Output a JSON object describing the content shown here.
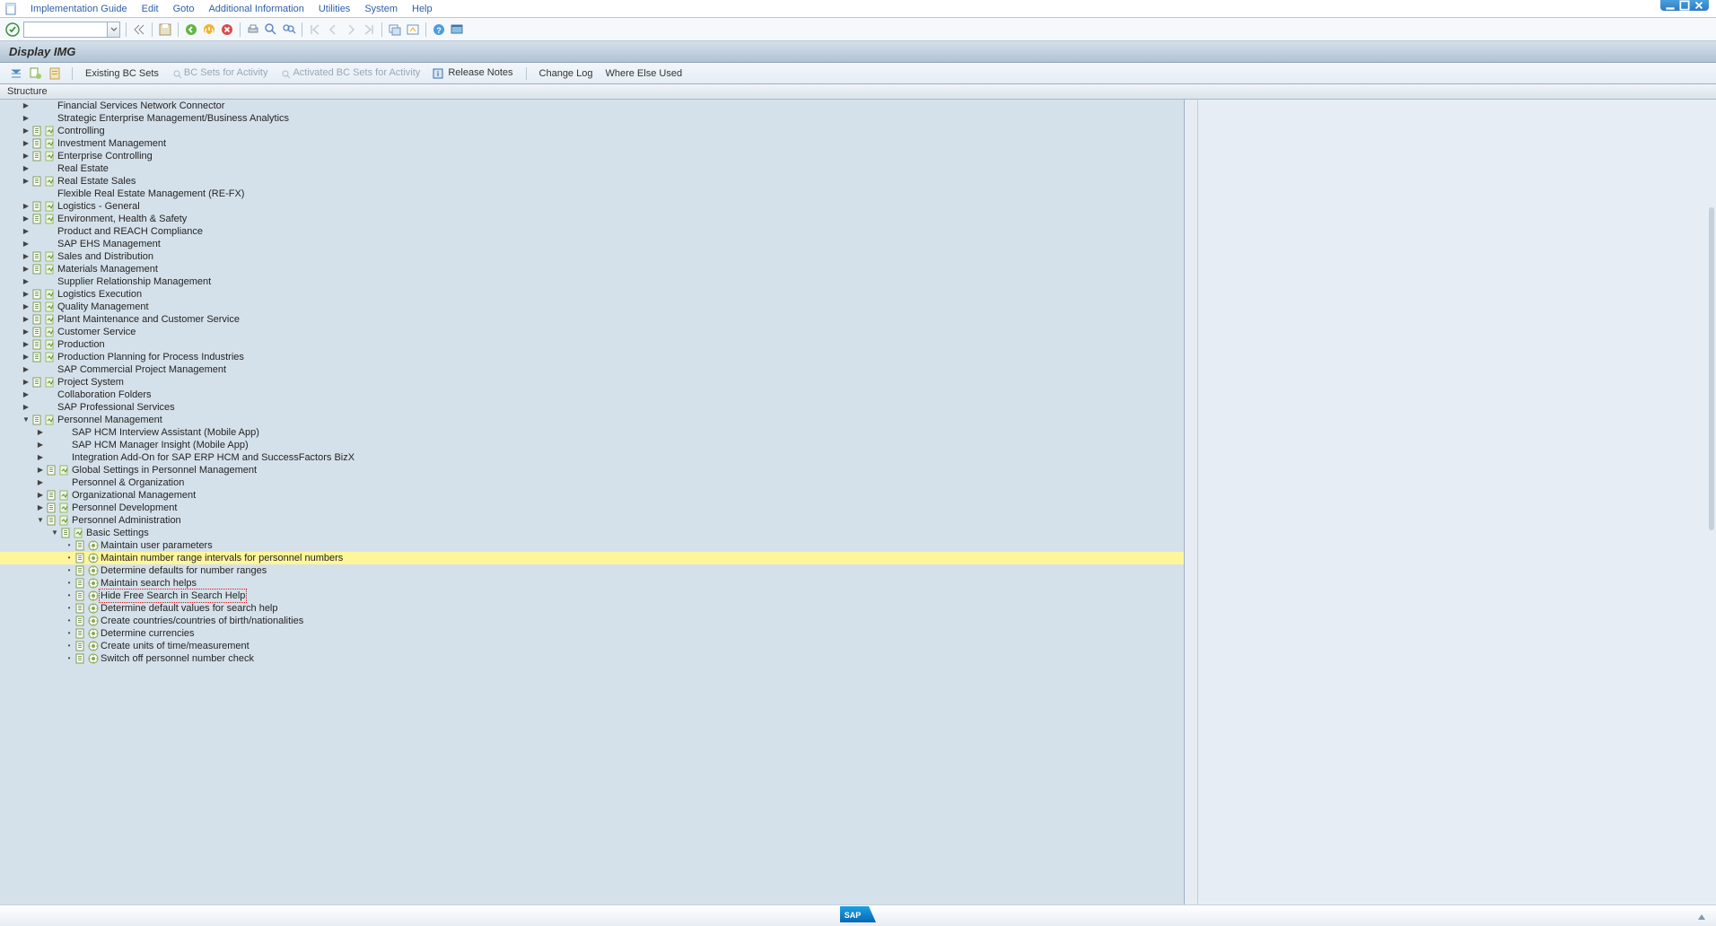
{
  "menu": {
    "items": [
      "Implementation Guide",
      "Edit",
      "Goto",
      "Additional Information",
      "Utilities",
      "System",
      "Help"
    ]
  },
  "title": "Display IMG",
  "app_toolbar": {
    "existing_bc_sets": "Existing BC Sets",
    "bc_sets_activity": "BC Sets for Activity",
    "activated_bc_sets": "Activated BC Sets for Activity",
    "release_notes": "Release Notes",
    "change_log": "Change Log",
    "where_else_used": "Where Else Used"
  },
  "tree_header": "Structure",
  "tree": [
    {
      "indent": 1,
      "exp": "closed",
      "doc": false,
      "act": false,
      "label": "Financial Services Network Connector"
    },
    {
      "indent": 1,
      "exp": "closed",
      "doc": false,
      "act": false,
      "label": "Strategic Enterprise Management/Business Analytics"
    },
    {
      "indent": 1,
      "exp": "closed",
      "doc": true,
      "act": true,
      "label": "Controlling"
    },
    {
      "indent": 1,
      "exp": "closed",
      "doc": true,
      "act": true,
      "label": "Investment Management"
    },
    {
      "indent": 1,
      "exp": "closed",
      "doc": true,
      "act": true,
      "label": "Enterprise Controlling"
    },
    {
      "indent": 1,
      "exp": "closed",
      "doc": false,
      "act": false,
      "label": "Real Estate"
    },
    {
      "indent": 1,
      "exp": "closed",
      "doc": true,
      "act": true,
      "label": "Real Estate Sales"
    },
    {
      "indent": 1,
      "exp": "none",
      "doc": false,
      "act": false,
      "label": "Flexible Real Estate Management (RE-FX)"
    },
    {
      "indent": 1,
      "exp": "closed",
      "doc": true,
      "act": true,
      "label": "Logistics - General"
    },
    {
      "indent": 1,
      "exp": "closed",
      "doc": true,
      "act": true,
      "label": "Environment, Health & Safety"
    },
    {
      "indent": 1,
      "exp": "closed",
      "doc": false,
      "act": false,
      "label": "Product and REACH Compliance"
    },
    {
      "indent": 1,
      "exp": "closed",
      "doc": false,
      "act": false,
      "label": "SAP EHS Management"
    },
    {
      "indent": 1,
      "exp": "closed",
      "doc": true,
      "act": true,
      "label": "Sales and Distribution"
    },
    {
      "indent": 1,
      "exp": "closed",
      "doc": true,
      "act": true,
      "label": "Materials Management"
    },
    {
      "indent": 1,
      "exp": "closed",
      "doc": false,
      "act": false,
      "label": "Supplier Relationship Management"
    },
    {
      "indent": 1,
      "exp": "closed",
      "doc": true,
      "act": true,
      "label": "Logistics Execution"
    },
    {
      "indent": 1,
      "exp": "closed",
      "doc": true,
      "act": true,
      "label": "Quality Management"
    },
    {
      "indent": 1,
      "exp": "closed",
      "doc": true,
      "act": true,
      "label": "Plant Maintenance and Customer Service"
    },
    {
      "indent": 1,
      "exp": "closed",
      "doc": true,
      "act": true,
      "label": "Customer Service"
    },
    {
      "indent": 1,
      "exp": "closed",
      "doc": true,
      "act": true,
      "label": "Production"
    },
    {
      "indent": 1,
      "exp": "closed",
      "doc": true,
      "act": true,
      "label": "Production Planning for Process Industries"
    },
    {
      "indent": 1,
      "exp": "closed",
      "doc": false,
      "act": false,
      "label": "SAP Commercial Project Management"
    },
    {
      "indent": 1,
      "exp": "closed",
      "doc": true,
      "act": true,
      "label": "Project System"
    },
    {
      "indent": 1,
      "exp": "closed",
      "doc": false,
      "act": false,
      "label": "Collaboration Folders"
    },
    {
      "indent": 1,
      "exp": "closed",
      "doc": false,
      "act": false,
      "label": "SAP Professional Services"
    },
    {
      "indent": 1,
      "exp": "open",
      "doc": true,
      "act": true,
      "label": "Personnel Management"
    },
    {
      "indent": 2,
      "exp": "closed",
      "doc": false,
      "act": false,
      "label": "SAP HCM Interview Assistant (Mobile App)"
    },
    {
      "indent": 2,
      "exp": "closed",
      "doc": false,
      "act": false,
      "label": "SAP HCM Manager Insight (Mobile App)"
    },
    {
      "indent": 2,
      "exp": "closed",
      "doc": false,
      "act": false,
      "label": "Integration Add-On for SAP ERP HCM and SuccessFactors BizX"
    },
    {
      "indent": 2,
      "exp": "closed",
      "doc": true,
      "act": true,
      "label": "Global Settings in Personnel Management"
    },
    {
      "indent": 2,
      "exp": "closed",
      "doc": false,
      "act": false,
      "label": "Personnel & Organization"
    },
    {
      "indent": 2,
      "exp": "closed",
      "doc": true,
      "act": true,
      "label": "Organizational Management"
    },
    {
      "indent": 2,
      "exp": "closed",
      "doc": true,
      "act": true,
      "label": "Personnel Development"
    },
    {
      "indent": 2,
      "exp": "open",
      "doc": true,
      "act": true,
      "label": "Personnel Administration"
    },
    {
      "indent": 3,
      "exp": "open",
      "doc": true,
      "act": true,
      "label": "Basic Settings"
    },
    {
      "indent": 4,
      "exp": "leaf",
      "doc": true,
      "act": true,
      "exec": true,
      "label": "Maintain user parameters"
    },
    {
      "indent": 4,
      "exp": "leaf",
      "doc": true,
      "act": true,
      "exec": true,
      "label": "Maintain number range intervals for personnel numbers",
      "highlighted": true
    },
    {
      "indent": 4,
      "exp": "leaf",
      "doc": true,
      "act": true,
      "exec": true,
      "label": "Determine defaults for number ranges"
    },
    {
      "indent": 4,
      "exp": "leaf",
      "doc": true,
      "act": true,
      "exec": true,
      "label": "Maintain search helps"
    },
    {
      "indent": 4,
      "exp": "leaf",
      "doc": true,
      "act": true,
      "exec": true,
      "label": "Hide Free Search in Search Help",
      "selected": true
    },
    {
      "indent": 4,
      "exp": "leaf",
      "doc": true,
      "act": true,
      "exec": true,
      "label": "Determine default values for search help"
    },
    {
      "indent": 4,
      "exp": "leaf",
      "doc": true,
      "act": true,
      "exec": true,
      "label": "Create countries/countries of birth/nationalities"
    },
    {
      "indent": 4,
      "exp": "leaf",
      "doc": true,
      "act": true,
      "exec": true,
      "label": "Determine currencies"
    },
    {
      "indent": 4,
      "exp": "leaf",
      "doc": true,
      "act": true,
      "exec": true,
      "label": "Create units of time/measurement"
    },
    {
      "indent": 4,
      "exp": "leaf",
      "doc": true,
      "act": true,
      "exec": true,
      "label": "Switch off personnel number check"
    }
  ]
}
